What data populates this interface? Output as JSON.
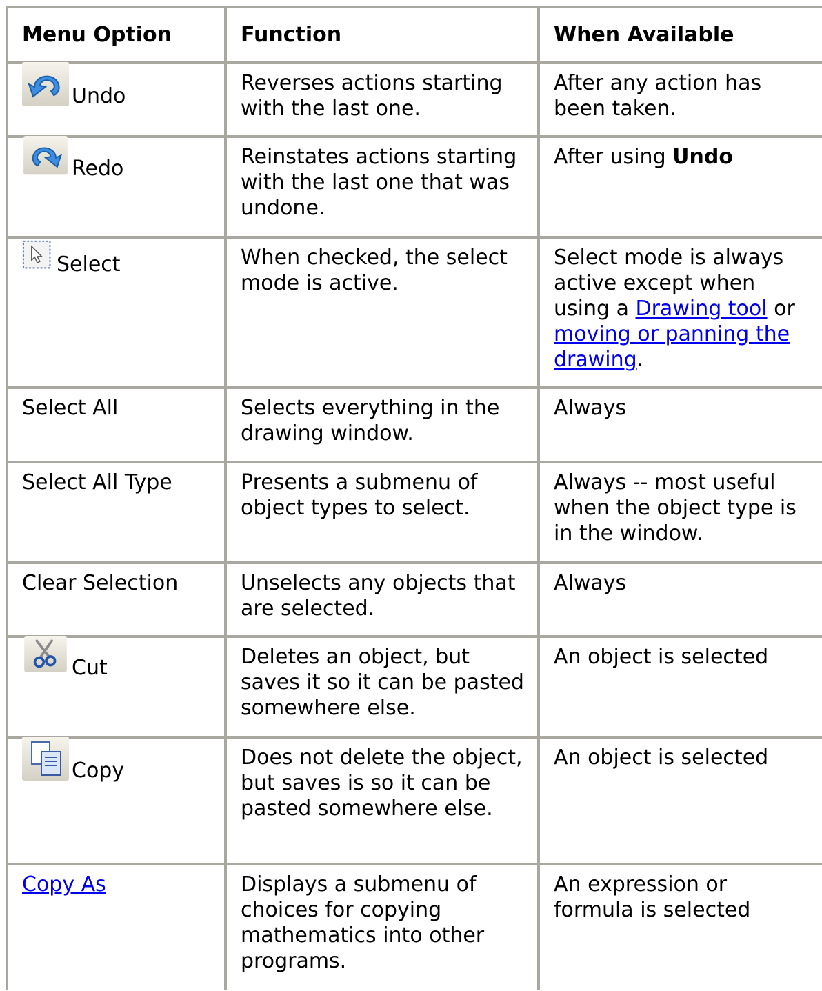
{
  "headers": [
    "Menu Option",
    "Function",
    "When Available"
  ],
  "rows": [
    {
      "option": "Undo",
      "icon": "undo-icon",
      "function": "Reverses actions starting with the last one.",
      "when": "After any action has been taken."
    },
    {
      "option": "Redo",
      "icon": "redo-icon",
      "function": "Reinstates actions starting with the last one that was undone.",
      "when_prefix": "After using ",
      "when_bold": "Undo"
    },
    {
      "option": "Select",
      "icon": "select-arrow-icon",
      "function": "When checked, the select mode is active.",
      "when_prefix": "Select mode is always active except when using a ",
      "when_link1": "Drawing tool",
      "when_mid": " or ",
      "when_link2": "moving or panning the drawing",
      "when_suffix": "."
    },
    {
      "option": "Select All",
      "function": "Selects everything in the drawing window.",
      "when": "Always"
    },
    {
      "option": "Select All Type",
      "function": "Presents a submenu of object types to select.",
      "when": "Always -- most useful when the object type is in the window."
    },
    {
      "option": "Clear Selection",
      "function": "Unselects any objects that are selected.",
      "when": "Always"
    },
    {
      "option": "Cut",
      "icon": "scissors-icon",
      "function": "Deletes an object, but saves it so it can be pasted somewhere else.",
      "when": "An object is selected"
    },
    {
      "option": "Copy",
      "icon": "copy-icon",
      "function": "Does not delete the object, but saves is so it can be pasted somewhere else.",
      "when": "An object is selected"
    },
    {
      "option": "Copy As",
      "option_is_link": true,
      "function": "Displays a submenu of choices for copying mathematics into other programs.",
      "when": "An expression or formula is selected"
    }
  ],
  "colors": {
    "border": "#a8a8a0",
    "link": "#0000ee"
  }
}
